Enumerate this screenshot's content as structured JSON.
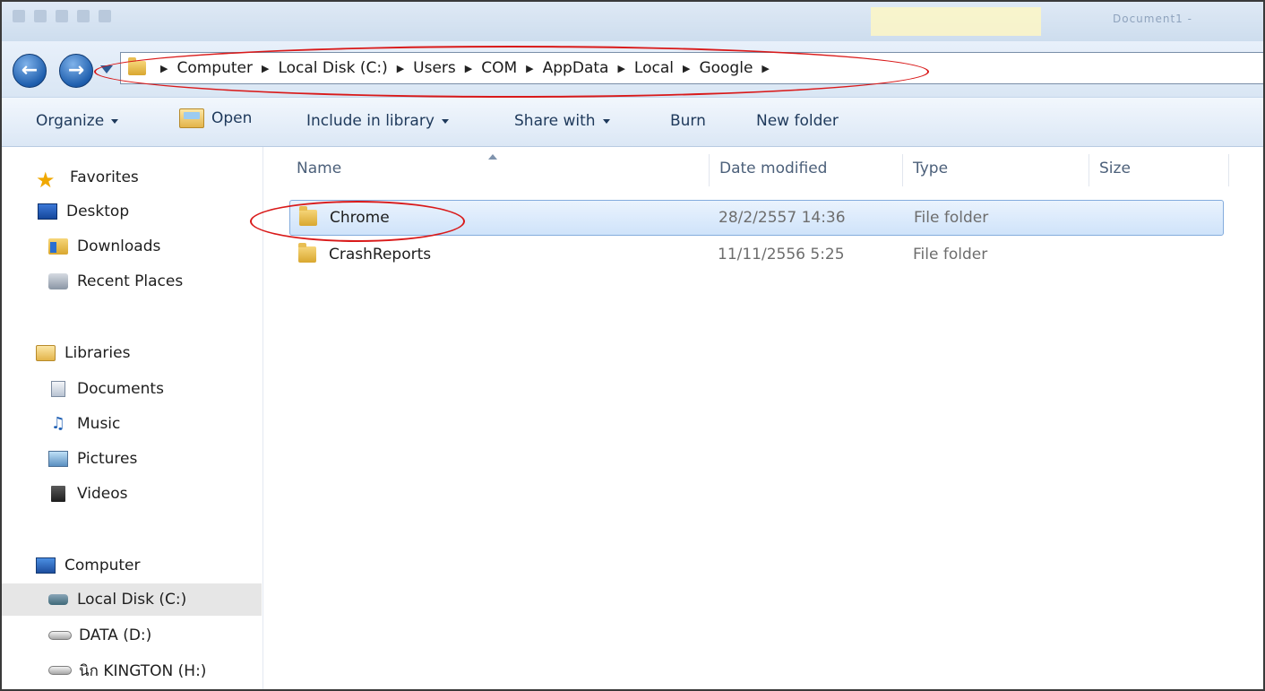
{
  "window": {
    "title_partial": "Document1 -"
  },
  "address": {
    "breadcrumbs": [
      {
        "label": "Computer"
      },
      {
        "label": "Local Disk (C:)"
      },
      {
        "label": "Users"
      },
      {
        "label": "COM"
      },
      {
        "label": "AppData"
      },
      {
        "label": "Local"
      },
      {
        "label": "Google"
      }
    ]
  },
  "toolbar": {
    "organize": "Organize",
    "open": "Open",
    "include_in_library": "Include in library",
    "share_with": "Share with",
    "burn": "Burn",
    "new_folder": "New folder"
  },
  "nav": {
    "favorites": {
      "label": "Favorites",
      "items": [
        {
          "label": "Desktop",
          "icon": "desktop-icon"
        },
        {
          "label": "Downloads",
          "icon": "downloads-icon"
        },
        {
          "label": "Recent Places",
          "icon": "recent-places-icon"
        }
      ]
    },
    "libraries": {
      "label": "Libraries",
      "items": [
        {
          "label": "Documents",
          "icon": "documents-icon"
        },
        {
          "label": "Music",
          "icon": "music-icon"
        },
        {
          "label": "Pictures",
          "icon": "pictures-icon"
        },
        {
          "label": "Videos",
          "icon": "videos-icon"
        }
      ]
    },
    "computer": {
      "label": "Computer",
      "items": [
        {
          "label": "Local Disk (C:)",
          "icon": "local-disk-icon",
          "selected": true
        },
        {
          "label": "DATA (D:)",
          "icon": "drive-icon"
        },
        {
          "label": "นิก KINGTON (H:)",
          "icon": "drive-icon"
        }
      ]
    }
  },
  "files": {
    "columns": {
      "name": "Name",
      "date_modified": "Date modified",
      "type": "Type",
      "size": "Size"
    },
    "rows": [
      {
        "name": "Chrome",
        "date_modified": "28/2/2557 14:36",
        "type": "File folder",
        "size": "",
        "selected": true
      },
      {
        "name": "CrashReports",
        "date_modified": "11/11/2556 5:25",
        "type": "File folder",
        "size": ""
      }
    ]
  },
  "colors": {
    "annotation": "#d91a1a",
    "selection": "#cfe3fa",
    "toolbar_text": "#1e395b"
  }
}
